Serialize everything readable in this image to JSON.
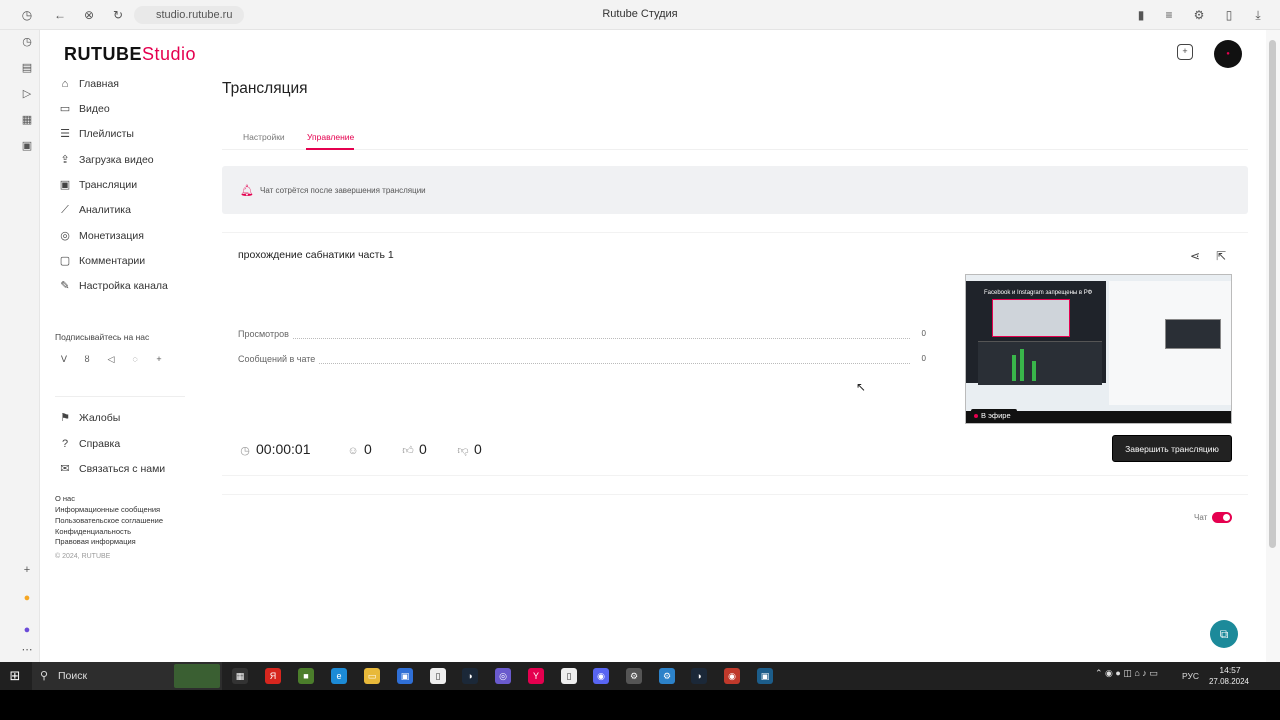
{
  "browser": {
    "url": "studio.rutube.ru",
    "title": "Rutube Студия"
  },
  "brand": {
    "logo_main": "RUTUBE",
    "logo_studio": "Studio",
    "accent": "#e5004f"
  },
  "sidebar": {
    "items": [
      {
        "label": "Главная",
        "icon": "home-icon"
      },
      {
        "label": "Видео",
        "icon": "video-icon"
      },
      {
        "label": "Плейлисты",
        "icon": "playlist-icon"
      },
      {
        "label": "Загрузка видео",
        "icon": "upload-icon"
      },
      {
        "label": "Трансляции",
        "icon": "broadcast-icon"
      },
      {
        "label": "Аналитика",
        "icon": "analytics-icon"
      },
      {
        "label": "Монетизация",
        "icon": "monetization-icon"
      },
      {
        "label": "Комментарии",
        "icon": "comments-icon"
      },
      {
        "label": "Настройка канала",
        "icon": "settings-icon"
      }
    ],
    "follow_title": "Подписывайтесь на нас",
    "support_items": [
      {
        "label": "Жалобы",
        "icon": "flag-icon"
      },
      {
        "label": "Справка",
        "icon": "help-icon"
      },
      {
        "label": "Связаться с нами",
        "icon": "contact-icon"
      }
    ],
    "footer_links": [
      "О нас",
      "Информационные сообщения",
      "Пользовательское соглашение",
      "Конфиденциальность",
      "Правовая информация"
    ],
    "copyright": "© 2024, RUTUBE"
  },
  "main": {
    "title": "Трансляция",
    "tabs": [
      {
        "label": "Настройки",
        "active": false
      },
      {
        "label": "Управление",
        "active": true
      }
    ],
    "notice": "Чат сотрётся после завершения трансляции",
    "stream": {
      "name": "прохождение сабнатики часть 1",
      "stats": [
        {
          "label": "Просмотров",
          "value": "0"
        },
        {
          "label": "Сообщений в чате",
          "value": "0"
        }
      ],
      "duration": "00:00:01",
      "viewers": "0",
      "likes": "0",
      "dislikes": "0",
      "preview_headline": "Facebook и Instagram запрещены в РФ",
      "live_label": "В эфире",
      "end_button": "Завершить трансляцию"
    },
    "chat": {
      "label": "Чат",
      "enabled": true
    }
  },
  "taskbar": {
    "search_placeholder": "Поиск",
    "lang": "РУС",
    "time": "14:57",
    "date": "27.08.2024"
  }
}
